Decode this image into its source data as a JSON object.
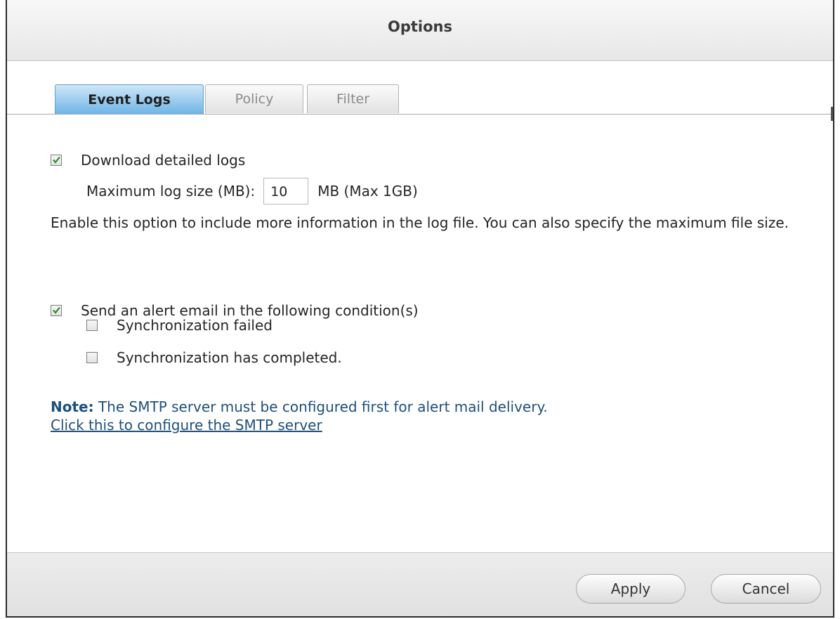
{
  "dialog": {
    "title": "Options"
  },
  "tabs": [
    {
      "label": "Event Logs",
      "active": true
    },
    {
      "label": "Policy",
      "active": false
    },
    {
      "label": "Filter",
      "active": false
    }
  ],
  "event_logs": {
    "download_detailed": {
      "label": "Download detailed logs",
      "checked": true
    },
    "max_log_size": {
      "label": "Maximum log size (MB):",
      "value": "10",
      "suffix": "MB (Max 1GB)"
    },
    "description": "Enable this option to include more information in the log file. You can also specify the maximum file size.",
    "alert_email": {
      "label": "Send an alert email in the following condition(s)",
      "checked": true
    },
    "conditions": [
      {
        "label": "Synchronization failed",
        "checked": false
      },
      {
        "label": "Synchronization has completed.",
        "checked": false
      }
    ],
    "note": {
      "prefix": "Note:",
      "text": " The SMTP server must be configured first for alert mail delivery.",
      "link": "Click this to configure the SMTP server"
    }
  },
  "footer": {
    "apply_label": "Apply",
    "cancel_label": "Cancel"
  },
  "colors": {
    "accent_tab": "#6fb5e6",
    "check": "#2c8a2c",
    "note": "#1e4f7c"
  }
}
